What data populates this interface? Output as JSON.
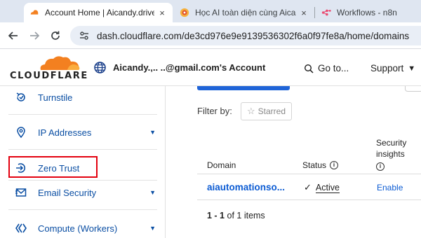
{
  "browser": {
    "tabs": [
      {
        "title": "Account Home | Aicandy.drive",
        "active": true,
        "favicon": "cloudflare-favicon"
      },
      {
        "title": "Học AI toàn diện cùng Aicandy",
        "active": false,
        "favicon": "aicandy-favicon"
      },
      {
        "title": "Workflows - n8n",
        "active": false,
        "favicon": "n8n-favicon"
      }
    ],
    "tab_close_glyph": "×",
    "url": "dash.cloudflare.com/de3cd976e9e9139536302f6a0f97fe8a/home/domains"
  },
  "header": {
    "logo_text": "CLOUDFLARE",
    "account_label": "Aicandy.‚.. ..@gmail.com's Account",
    "goto_label": "Go to...",
    "support_label": "Support"
  },
  "sidebar": {
    "items": [
      {
        "label": "Turnstile",
        "icon": "turnstile-icon",
        "has_chevron": false
      },
      {
        "label": "IP Addresses",
        "icon": "location-pin-icon",
        "has_chevron": true
      },
      {
        "label": "Zero Trust",
        "icon": "zero-trust-icon",
        "has_chevron": false,
        "highlighted": true
      },
      {
        "label": "Email Security",
        "icon": "envelope-icon",
        "has_chevron": true
      },
      {
        "label": "Compute (Workers)",
        "icon": "workers-icon",
        "has_chevron": true
      }
    ],
    "chevron_glyph": "▼",
    "highlight_color": "#e3000f"
  },
  "main": {
    "filter_label": "Filter by:",
    "starred_chip": "Starred",
    "star_glyph": "☆",
    "columns": {
      "domain": "Domain",
      "status": "Status",
      "security_line1": "Security",
      "security_line2": "insights"
    },
    "info_glyph": "i",
    "row": {
      "domain": "aiautomationso...",
      "status": "Active",
      "check_glyph": "✓",
      "security": "Enable"
    },
    "pager": {
      "range": "1 - 1",
      "suffix": "of 1 items"
    }
  },
  "colors": {
    "accent_link": "#0b5bd3",
    "cloudflare_orange": "#f38020",
    "primary_button": "#1f64d8"
  }
}
